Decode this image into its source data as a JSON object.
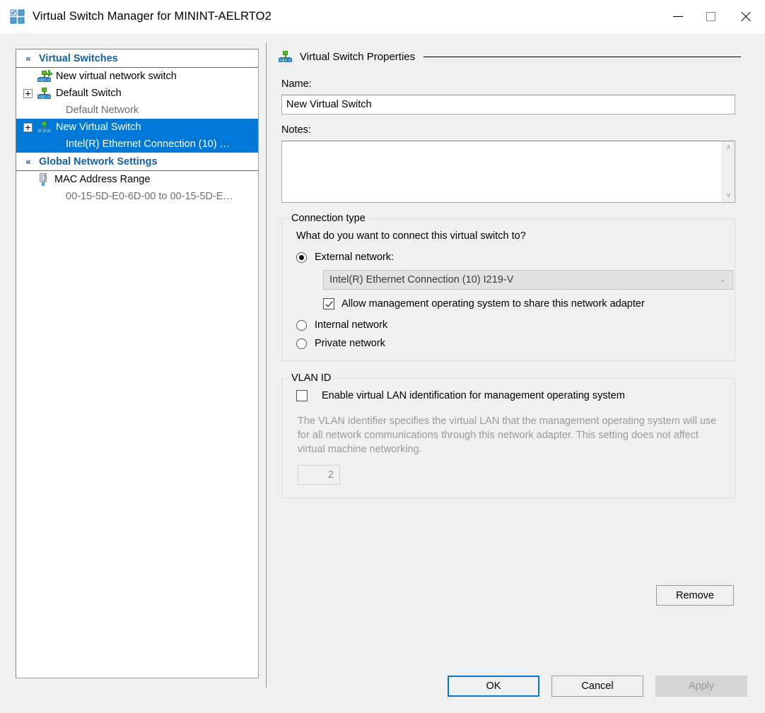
{
  "window": {
    "title": "Virtual Switch Manager for MININT-AELRTO2",
    "icon": "virtual-switch-manager-icon",
    "controls": {
      "minimize": "minimize-icon",
      "maximize": "maximize-icon",
      "close": "close-icon"
    }
  },
  "tree": {
    "sections": [
      {
        "header": "Virtual Switches",
        "chevron": "«",
        "items": [
          {
            "label": "New virtual network switch",
            "icon": "new-virtual-switch-icon",
            "expandable": false,
            "selected": false
          },
          {
            "label": "Default Switch",
            "sub": "Default Network",
            "icon": "virtual-switch-icon",
            "expandable": true,
            "selected": false
          },
          {
            "label": "New Virtual Switch",
            "sub": "Intel(R) Ethernet Connection (10) …",
            "icon": "virtual-switch-icon",
            "expandable": true,
            "selected": true
          }
        ]
      },
      {
        "header": "Global Network Settings",
        "chevron": "«",
        "items": [
          {
            "label": "MAC Address Range",
            "sub": "00-15-5D-E0-6D-00 to 00-15-5D-E…",
            "icon": "mac-address-icon",
            "expandable": false,
            "selected": false
          }
        ]
      }
    ]
  },
  "properties": {
    "section_title": "Virtual Switch Properties",
    "section_icon": "virtual-switch-icon",
    "name_label": "Name:",
    "name_value": "New Virtual Switch",
    "notes_label": "Notes:",
    "notes_value": "",
    "notes_placeholder": "",
    "scroll_up": "∧",
    "scroll_down": "∨"
  },
  "connection_type": {
    "legend": "Connection type",
    "question": "What do you want to connect this virtual switch to?",
    "options": [
      {
        "label": "External network:",
        "selected": true
      },
      {
        "label": "Internal network",
        "selected": false
      },
      {
        "label": "Private network",
        "selected": false
      }
    ],
    "adapter_value": "Intel(R) Ethernet Connection (10) I219-V",
    "adapter_chevron": "⌄",
    "share_checkbox_label": "Allow management operating system to share this network adapter",
    "share_checkbox_checked": true
  },
  "vlan": {
    "legend": "VLAN ID",
    "checkbox_label": "Enable virtual LAN identification for management operating system",
    "checkbox_checked": false,
    "description": "The VLAN identifier specifies the virtual LAN that the management operating system will use for all network communications through this network adapter. This setting does not affect virtual machine networking.",
    "value": "2"
  },
  "buttons": {
    "remove": "Remove",
    "ok": "OK",
    "cancel": "Cancel",
    "apply": "Apply"
  },
  "colors": {
    "selection_blue": "#0078d7",
    "header_blue": "#1560a8",
    "dialog_bg": "#f0f0f0",
    "muted_text": "#9a9a9a"
  }
}
